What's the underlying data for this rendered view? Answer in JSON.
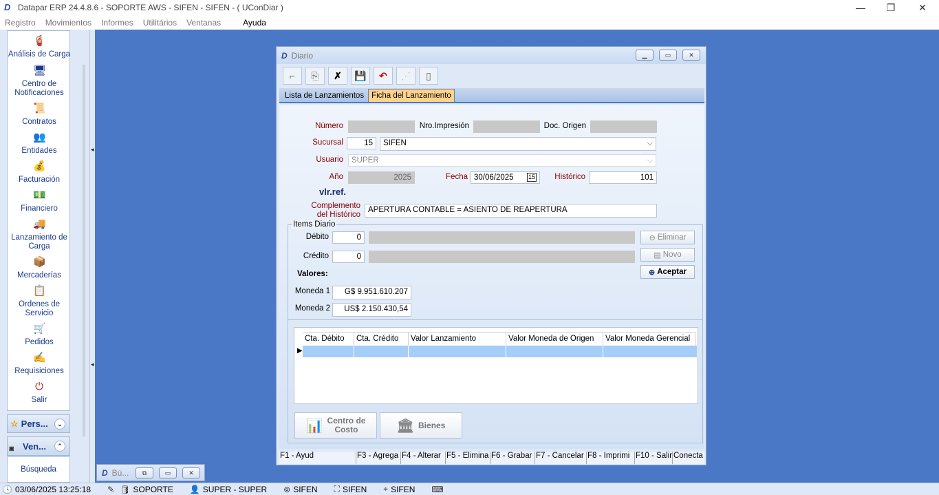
{
  "app": {
    "title": "Datapar ERP 24.4.8.6 - SOPORTE AWS - SIFEN - SIFEN -  ( UConDiar )",
    "logo": "D"
  },
  "window_controls": {
    "minimize": "—",
    "restore": "❐",
    "close": "✕"
  },
  "menu": {
    "items": [
      "Registro",
      "Movimientos",
      "Informes",
      "Utilitários",
      "Ventanas",
      "Ayuda"
    ]
  },
  "sidebar": {
    "items": [
      {
        "label": "Análisis de Carga",
        "icon": "analysis-icon",
        "glyph": "🧯"
      },
      {
        "label": "Centro de Notificaciones",
        "icon": "notification-icon",
        "glyph": "🖥"
      },
      {
        "label": "Contratos",
        "icon": "contract-icon",
        "glyph": "📜"
      },
      {
        "label": "Entidades",
        "icon": "entities-icon",
        "glyph": "👥"
      },
      {
        "label": "Facturación",
        "icon": "billing-icon",
        "glyph": "💰"
      },
      {
        "label": "Financiero",
        "icon": "finance-icon",
        "glyph": "💵"
      },
      {
        "label": "Lanzamiento de Carga",
        "icon": "truck-icon",
        "glyph": "🚚"
      },
      {
        "label": "Mercaderías",
        "icon": "goods-icon",
        "glyph": "📦"
      },
      {
        "label": "Ordenes de Servicio",
        "icon": "service-order-icon",
        "glyph": "📋"
      },
      {
        "label": "Pedidos",
        "icon": "orders-icon",
        "glyph": "🛒"
      },
      {
        "label": "Requisiciones",
        "icon": "requisition-icon",
        "glyph": "✍"
      },
      {
        "label": "Salir",
        "icon": "exit-icon",
        "glyph": "⏻"
      }
    ],
    "groups": {
      "pers": "Pers...",
      "ven": "Ven...",
      "busqueda": "Búsqueda"
    }
  },
  "diario": {
    "title": "Diario",
    "logo": "D",
    "toolbar": [
      "new",
      "copy",
      "cancel",
      "save",
      "undo",
      "disabled",
      "report"
    ],
    "tabs": [
      "Lista de Lanzamientos",
      "Ficha del Lanzamiento"
    ],
    "active_tab": 1,
    "labels": {
      "numero": "Número",
      "nro_impresion": "Nro.Impresión",
      "doc_origen": "Doc. Origen",
      "sucursal": "Sucursal",
      "usuario": "Usuario",
      "anio": "Año",
      "fecha": "Fecha",
      "historico": "Histórico",
      "vlr_ref": "vlr.ref.",
      "complemento_1": "Complemento",
      "complemento_2": "del Histórico",
      "items_diario": "Items Diario",
      "debito": "Débito",
      "credito": "Crédito",
      "valores": "Valores:",
      "moneda1": "Moneda 1",
      "moneda2": "Moneda 2"
    },
    "values": {
      "numero": "",
      "nro_impresion": "",
      "doc_origen": "",
      "sucursal_code": "15",
      "sucursal_name": "SIFEN",
      "usuario": "SUPER",
      "anio": "2025",
      "fecha": "30/06/2025",
      "historico": "101",
      "complemento": "APERTURA CONTABLE = ASIENTO DE REAPERTURA",
      "debito": "0",
      "debito_desc": "",
      "credito": "0",
      "credito_desc": "",
      "moneda1": "G$ 9.951.610.207",
      "moneda2": "US$ 2.150.430,54"
    },
    "buttons": {
      "eliminar": "Eliminar",
      "novo": "Novo",
      "aceptar": "Aceptar",
      "centro_costo_1": "Centro de",
      "centro_costo_2": "Costo",
      "bienes": "Bienes"
    },
    "grid": {
      "columns": [
        "Cta. Débito",
        "Cta. Crédito",
        "Valor Lanzamiento",
        "Valor Moneda de Origen",
        "Valor Moneda Gerencial"
      ],
      "rows": [
        [
          "",
          "",
          "",
          "",
          ""
        ]
      ]
    },
    "fkeys": [
      "F1 - Ayud",
      "F3 - Agrega",
      "F4 - Alterar",
      "F5 - Elimina",
      "F6 - Grabar",
      "F7 - Cancelar",
      "F8 - Imprimi",
      "F10 - Salir",
      "Conecta"
    ]
  },
  "busqueda_window": {
    "title": "Bú..."
  },
  "status": {
    "datetime": "03/06/2025 13:25:18",
    "db": "SOPORTE",
    "user": "SUPER - SUPER",
    "location": "SIFEN",
    "company": "SIFEN",
    "branch": "SIFEN"
  }
}
